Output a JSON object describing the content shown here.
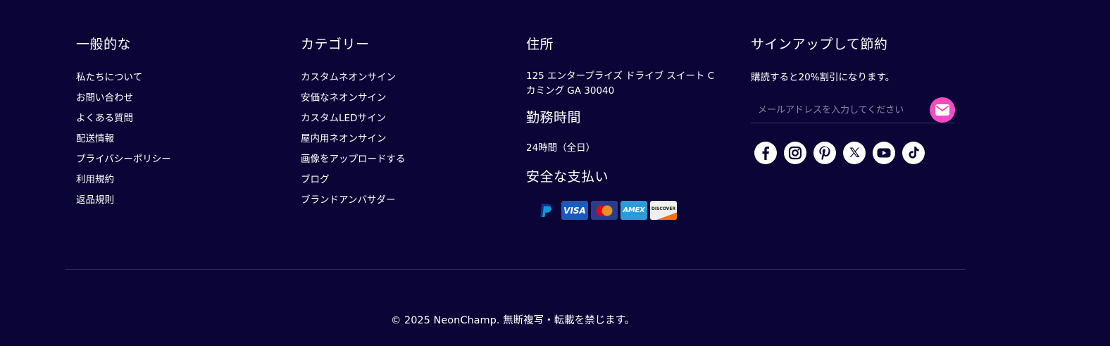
{
  "general": {
    "heading": "一般的な",
    "links": [
      "私たちについて",
      "お問い合わせ",
      "よくある質問",
      "配送情報",
      "プライバシーポリシー",
      "利用規約",
      "返品規則"
    ]
  },
  "categories": {
    "heading": "カテゴリー",
    "links": [
      "カスタムネオンサイン",
      "安価なネオンサイン",
      "カスタムLEDサイン",
      "屋内用ネオンサイン",
      "画像をアップロードする",
      "ブログ",
      "ブランドアンバサダー"
    ]
  },
  "address": {
    "heading": "住所",
    "line1": "125 エンタープライズ ドライブ スイート C",
    "line2": "カミング GA 30040",
    "hours_heading": "勤務時間",
    "hours": "24時間（全日）",
    "payment_heading": "安全な支払い",
    "payment_methods": [
      {
        "name": "paypal-icon",
        "label": "",
        "color": "#009cde"
      },
      {
        "name": "visa-icon",
        "label": "VISA",
        "color": "#1a5aba"
      },
      {
        "name": "mastercard-icon",
        "label": "",
        "color": "#2b3d8a"
      },
      {
        "name": "amex-icon",
        "label": "AMEX",
        "color": "#2e9ad6"
      },
      {
        "name": "discover-icon",
        "label": "DISCOVER",
        "color": "#f0f0f0"
      }
    ]
  },
  "signup": {
    "heading": "サインアップして節約",
    "text": "購読すると20%割引になります。",
    "email_placeholder": "メールアドレスを入力してください",
    "send_icon": "envelope-icon",
    "accent": "#ff49b2",
    "socials": [
      "facebook-icon",
      "instagram-icon",
      "pinterest-icon",
      "x-icon",
      "youtube-icon",
      "tiktok-icon"
    ]
  },
  "footer": {
    "copyright": "© 2025 NeonChamp. 無断複写・転載を禁じます。"
  },
  "colors": {
    "background": "#0a0536",
    "text": "#ffffff",
    "divider": "#2d2a5a"
  }
}
